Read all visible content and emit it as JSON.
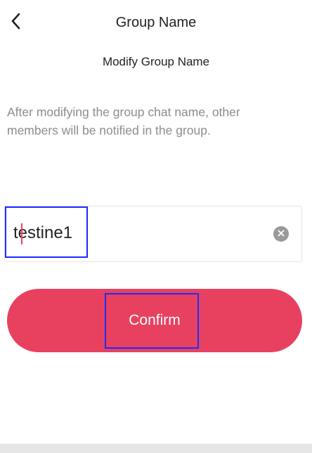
{
  "header": {
    "title": "Group Name",
    "back_icon": "chevron-left-icon"
  },
  "form": {
    "subtitle": "Modify Group Name",
    "description": "After modifying the group chat name, other members will be notified in the group.",
    "name_value": "testine1",
    "clear_icon": "clear-circle-icon"
  },
  "actions": {
    "confirm_label": "Confirm"
  },
  "colors": {
    "accent": "#e8415f",
    "annotation_box": "#1f2bff",
    "muted_text": "#8c8c8c"
  }
}
